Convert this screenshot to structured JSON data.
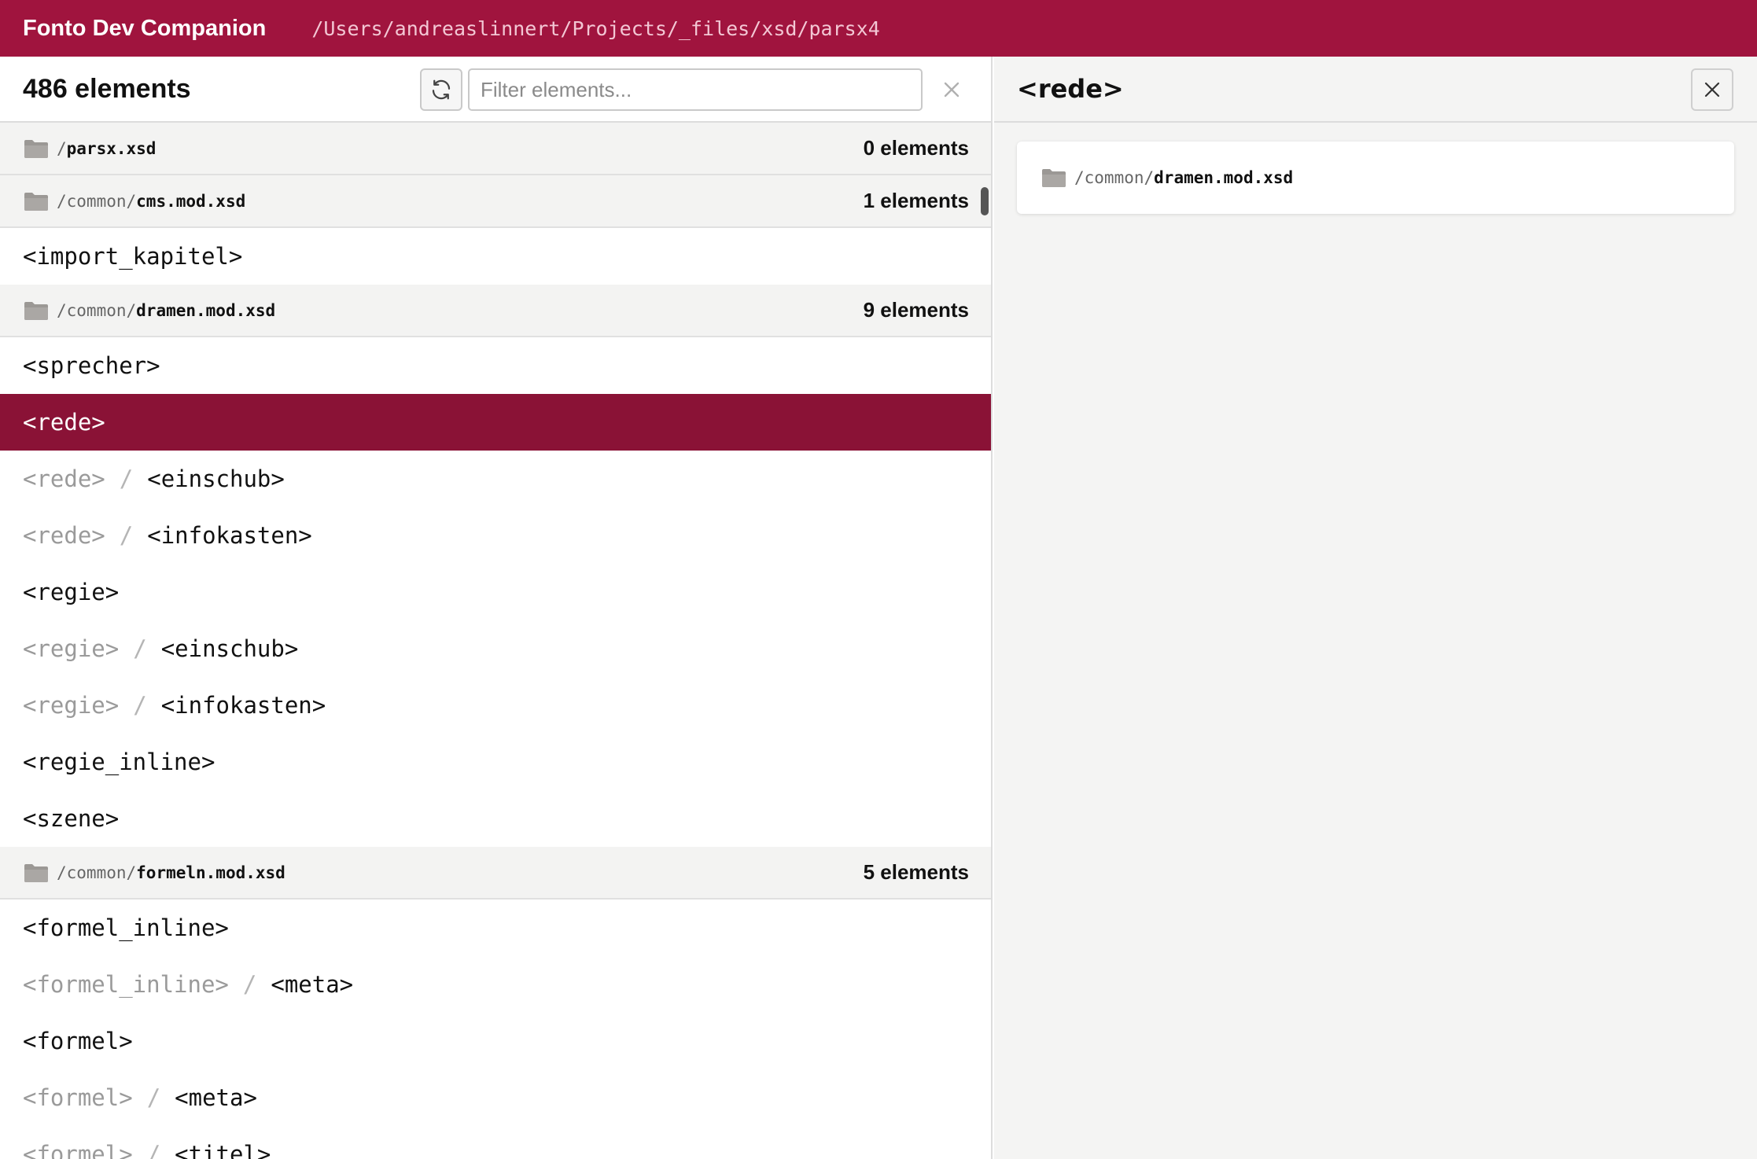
{
  "app": {
    "title": "Fonto Dev Companion",
    "path": "/Users/andreaslinnert/Projects/_files/xsd/parsx4"
  },
  "list_header": {
    "count_label": "486 elements",
    "filter_placeholder": "Filter elements...",
    "filter_value": ""
  },
  "groups": [
    {
      "dir": "/",
      "file": "parsx.xsd",
      "count": "0 elements",
      "rows": []
    },
    {
      "dir": "/common/",
      "file": "cms.mod.xsd",
      "count": "1 elements",
      "rows": [
        {
          "parent": "",
          "name": "<import_kapitel>"
        }
      ]
    },
    {
      "dir": "/common/",
      "file": "dramen.mod.xsd",
      "count": "9 elements",
      "rows": [
        {
          "parent": "",
          "name": "<sprecher>"
        },
        {
          "parent": "",
          "name": "<rede>",
          "selected": true
        },
        {
          "parent": "<rede>",
          "name": "<einschub>"
        },
        {
          "parent": "<rede>",
          "name": "<infokasten>"
        },
        {
          "parent": "",
          "name": "<regie>"
        },
        {
          "parent": "<regie>",
          "name": "<einschub>"
        },
        {
          "parent": "<regie>",
          "name": "<infokasten>"
        },
        {
          "parent": "",
          "name": "<regie_inline>"
        },
        {
          "parent": "",
          "name": "<szene>"
        }
      ]
    },
    {
      "dir": "/common/",
      "file": "formeln.mod.xsd",
      "count": "5 elements",
      "rows": [
        {
          "parent": "",
          "name": "<formel_inline>"
        },
        {
          "parent": "<formel_inline>",
          "name": "<meta>"
        },
        {
          "parent": "",
          "name": "<formel>"
        },
        {
          "parent": "<formel>",
          "name": "<meta>"
        },
        {
          "parent": "<formel>",
          "name": "<titel>"
        }
      ]
    }
  ],
  "path_separator": "/",
  "detail": {
    "title": "<rede>",
    "source_dir": "/common/",
    "source_file": "dramen.mod.xsd"
  },
  "colors": {
    "brand": "#a0143e",
    "selected_row": "#8a1236"
  },
  "icons": {
    "refresh": "refresh-icon",
    "clear": "close-icon",
    "folder": "folder-icon",
    "close": "close-icon"
  }
}
